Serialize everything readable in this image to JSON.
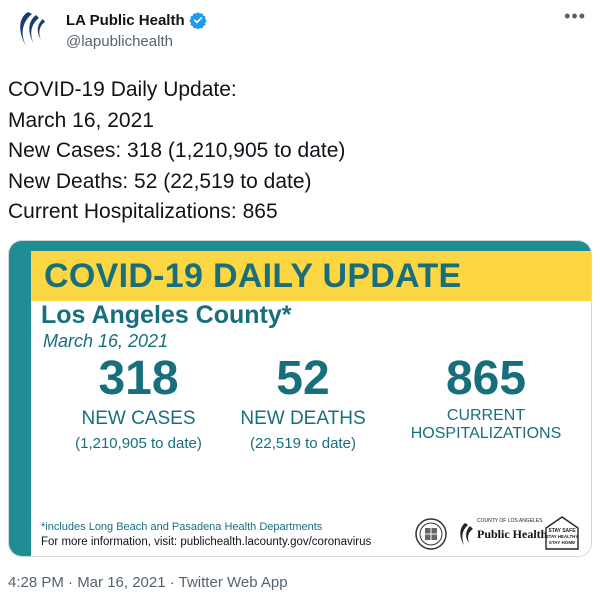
{
  "account": {
    "name": "LA Public Health",
    "handle": "@lapublichealth"
  },
  "tweet": {
    "lines": [
      "COVID-19 Daily Update:",
      "March 16, 2021",
      "New Cases: 318 (1,210,905 to date)",
      "New Deaths: 52 (22,519 to date)",
      "Current Hospitalizations: 865"
    ]
  },
  "card": {
    "banner": "COVID-19 DAILY UPDATE",
    "county": "Los Angeles County*",
    "date": "March 16, 2021",
    "stats": {
      "cases": {
        "value": "318",
        "label": "NEW CASES",
        "sub": "(1,210,905 to date)"
      },
      "deaths": {
        "value": "52",
        "label": "NEW DEATHS",
        "sub": "(22,519 to date)"
      },
      "hospitalizations": {
        "value": "865",
        "label_line1": "CURRENT",
        "label_line2": "HOSPITALIZATIONS"
      }
    },
    "footnote": "*includes Long Beach and Pasadena Health Departments",
    "more_info": "For more information, visit: publichealth.lacounty.gov/coronavirus",
    "logos": {
      "ph_small": "COUNTY OF LOS ANGELES",
      "ph_big": "Public Health",
      "stay_lines": [
        "STAY SAFE",
        "STAY HEALTHY",
        "STAY HOME"
      ]
    }
  },
  "footer": {
    "meta": "4:28 PM · Mar 16, 2021 · Twitter Web App"
  },
  "colors": {
    "teal": "#1f8d93",
    "dark_teal": "#176f7d",
    "yellow": "#fdd643",
    "verified_blue": "#1d9bf0"
  },
  "icons": [
    "la-public-health-logo-icon",
    "verified-badge-icon",
    "more-icon",
    "county-seal-icon",
    "public-health-logo-icon",
    "stay-safe-icon"
  ]
}
